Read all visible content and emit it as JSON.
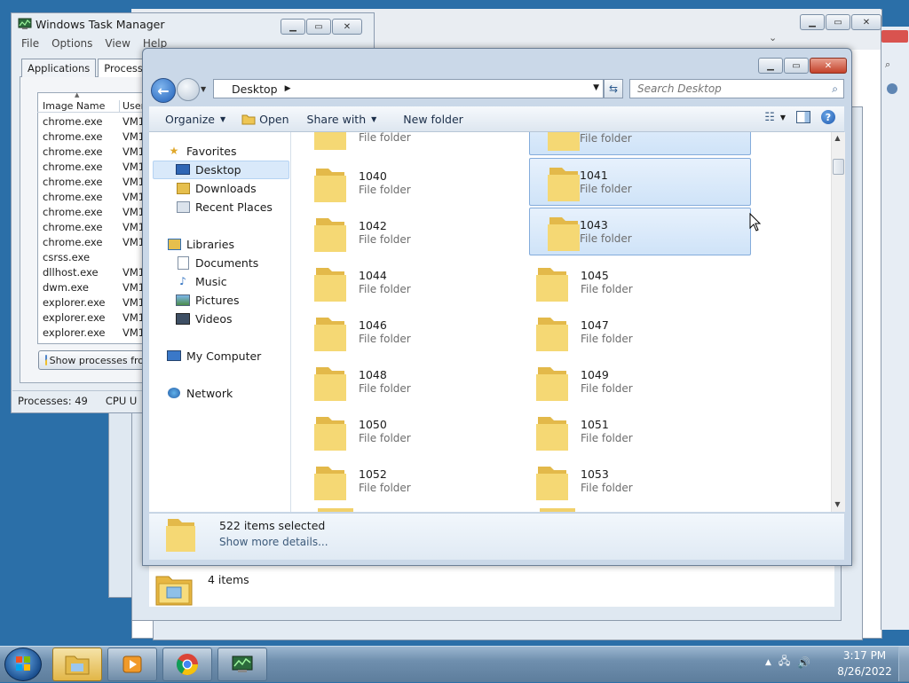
{
  "task_manager": {
    "title": "Windows Task Manager",
    "menu": [
      "File",
      "Options",
      "View",
      "Help"
    ],
    "tabs": [
      "Applications",
      "Processes"
    ],
    "active_tab": "Processes",
    "columns": [
      "Image Name",
      "User"
    ],
    "processes": [
      {
        "name": "chrome.exe",
        "user": "VM1"
      },
      {
        "name": "chrome.exe",
        "user": "VM1"
      },
      {
        "name": "chrome.exe",
        "user": "VM1"
      },
      {
        "name": "chrome.exe",
        "user": "VM1"
      },
      {
        "name": "chrome.exe",
        "user": "VM1"
      },
      {
        "name": "chrome.exe",
        "user": "VM1"
      },
      {
        "name": "chrome.exe",
        "user": "VM1"
      },
      {
        "name": "chrome.exe",
        "user": "VM1"
      },
      {
        "name": "chrome.exe",
        "user": "VM1"
      },
      {
        "name": "csrss.exe",
        "user": ""
      },
      {
        "name": "dllhost.exe",
        "user": "VM1"
      },
      {
        "name": "dwm.exe",
        "user": "VM1"
      },
      {
        "name": "explorer.exe",
        "user": "VM1"
      },
      {
        "name": "explorer.exe",
        "user": "VM1"
      },
      {
        "name": "explorer.exe",
        "user": "VM1"
      }
    ],
    "show_processes_button": "Show processes fro",
    "status_processes": "Processes: 49",
    "status_cpu": "CPU U"
  },
  "explorer": {
    "address": "Desktop",
    "search_placeholder": "Search Desktop",
    "toolbar": {
      "organize": "Organize",
      "open": "Open",
      "share_with": "Share with",
      "new_folder": "New folder"
    },
    "nav": {
      "favorites": "Favorites",
      "desktop": "Desktop",
      "downloads": "Downloads",
      "recent_places": "Recent Places",
      "libraries": "Libraries",
      "documents": "Documents",
      "music": "Music",
      "pictures": "Pictures",
      "videos": "Videos",
      "my_computer": "My Computer",
      "network": "Network"
    },
    "items": [
      {
        "name": "",
        "type": "File folder",
        "selected": false
      },
      {
        "name": "",
        "type": "File folder",
        "selected": true
      },
      {
        "name": "1040",
        "type": "File folder",
        "selected": false
      },
      {
        "name": "1041",
        "type": "File folder",
        "selected": true
      },
      {
        "name": "1042",
        "type": "File folder",
        "selected": false
      },
      {
        "name": "1043",
        "type": "File folder",
        "selected": true
      },
      {
        "name": "1044",
        "type": "File folder",
        "selected": false
      },
      {
        "name": "1045",
        "type": "File folder",
        "selected": false
      },
      {
        "name": "1046",
        "type": "File folder",
        "selected": false
      },
      {
        "name": "1047",
        "type": "File folder",
        "selected": false
      },
      {
        "name": "1048",
        "type": "File folder",
        "selected": false
      },
      {
        "name": "1049",
        "type": "File folder",
        "selected": false
      },
      {
        "name": "1050",
        "type": "File folder",
        "selected": false
      },
      {
        "name": "1051",
        "type": "File folder",
        "selected": false
      },
      {
        "name": "1052",
        "type": "File folder",
        "selected": false
      },
      {
        "name": "1053",
        "type": "File folder",
        "selected": false
      }
    ],
    "details": {
      "selection": "522 items selected",
      "more": "Show more details..."
    }
  },
  "background_explorer": {
    "status": "4 items"
  },
  "taskbar": {
    "time": "3:17 PM",
    "date": "8/26/2022"
  },
  "colors": {
    "selection_fill": "#cfe3f8",
    "selection_border": "#84acdb",
    "folder_yellow": "#f2cf5b",
    "taskbar": "#6f8fae"
  }
}
